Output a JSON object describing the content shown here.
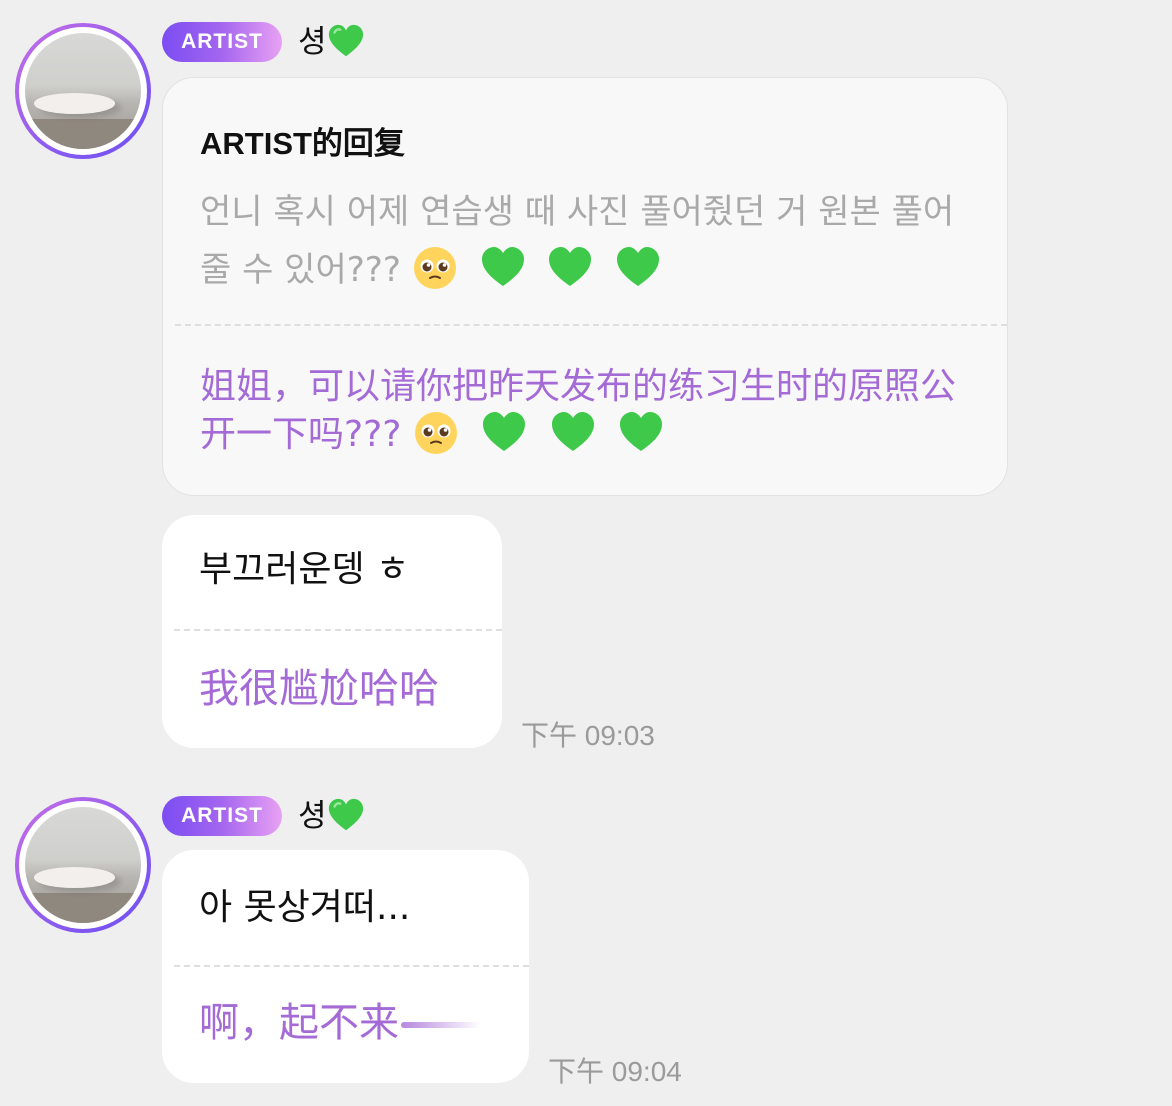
{
  "messages": [
    {
      "badge": "ARTIST",
      "sender": "셩",
      "sender_emoji": "green-heart",
      "reply_title": "ARTIST的回复",
      "quote_text": "언니 혹시 어제 연습생 때 사진 풀어줬던 거 원본 풀어줄 수 있어???",
      "quote_translation": "姐姐，可以请你把昨天发布的练习生时的原照公开一下吗???",
      "emojis": [
        "pleading-face",
        "green-heart",
        "green-heart",
        "green-heart"
      ]
    },
    {
      "text": "부끄러운뎅 ㅎ",
      "translation": "我很尴尬哈哈",
      "time": "下午 09:03"
    },
    {
      "badge": "ARTIST",
      "sender": "셩",
      "sender_emoji": "green-heart",
      "text": "아 못상겨떠...",
      "translation": "啊，起不来",
      "time": "下午 09:04"
    }
  ],
  "colors": {
    "background": "#efefef",
    "badge_gradient": [
      "#7b4df2",
      "#e8a1f3"
    ],
    "translation": "#a46ad6",
    "quote_text": "#a9a9a9",
    "time": "#9a9a9a",
    "heart": "#3fc94a"
  }
}
